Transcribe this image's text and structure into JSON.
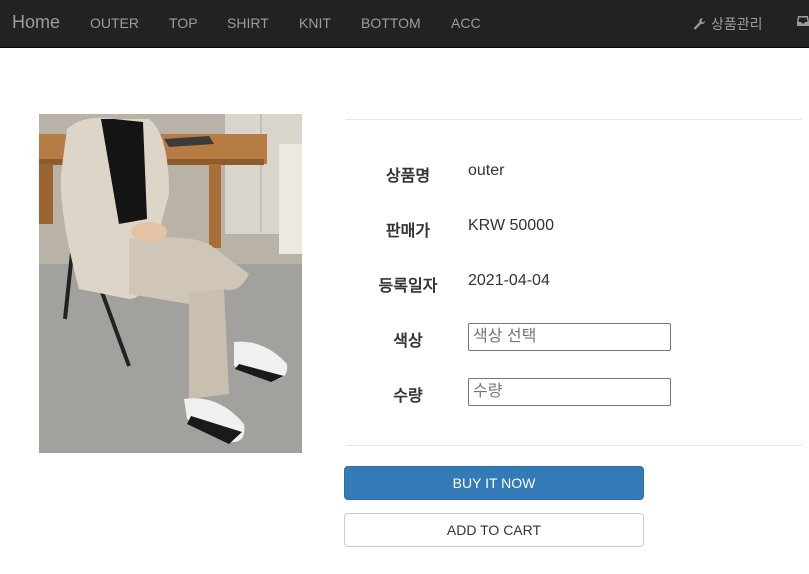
{
  "navbar": {
    "brand": "Home",
    "items": [
      "OUTER",
      "TOP",
      "SHIRT",
      "KNIT",
      "BOTTOM",
      "ACC"
    ],
    "admin_label": "상품관리"
  },
  "product": {
    "labels": {
      "name": "상품명",
      "price": "판매가",
      "date": "등록일자",
      "color": "색상",
      "quantity": "수량"
    },
    "name": "outer",
    "price": "KRW 50000",
    "date": "2021-04-04",
    "color_placeholder": "색상 선택",
    "quantity_placeholder": "수량"
  },
  "actions": {
    "buy": "BUY IT NOW",
    "cart": "ADD TO CART"
  },
  "colors": {
    "navbar_bg": "#222222",
    "nav_text": "#9d9d9d",
    "primary": "#337ab7"
  }
}
